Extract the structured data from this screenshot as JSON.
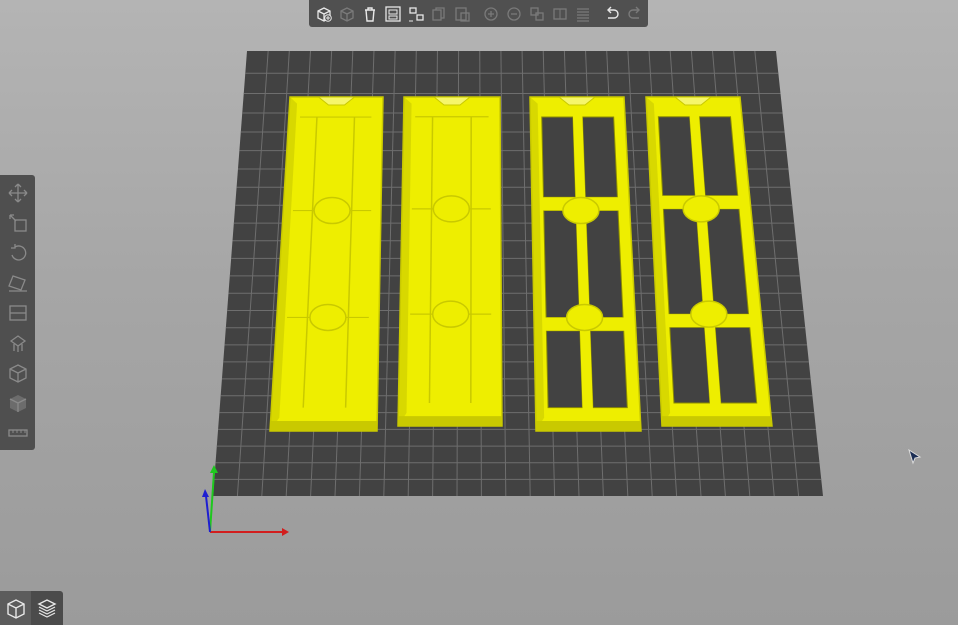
{
  "app": {
    "accent_color": "#eeee00",
    "bed_color": "#424242",
    "grid_color": "#6e6e6e"
  },
  "top_toolbar": {
    "buttons": [
      {
        "name": "add-button",
        "icon": "cube-add-icon",
        "enabled": true
      },
      {
        "name": "delete-button",
        "icon": "cube-delete-icon",
        "enabled": false
      },
      {
        "name": "delete-all-button",
        "icon": "trash-icon",
        "enabled": true
      },
      {
        "name": "arrange-button",
        "icon": "arrange-icon",
        "enabled": true
      },
      {
        "name": "arrange-selection-button",
        "icon": "arrange-selection-icon",
        "enabled": true
      },
      {
        "name": "copy-button",
        "icon": "copy-icon",
        "enabled": false
      },
      {
        "name": "paste-button",
        "icon": "paste-icon",
        "enabled": false
      },
      {
        "name": "add-instance-button",
        "icon": "plus-circle-icon",
        "enabled": false
      },
      {
        "name": "remove-instance-button",
        "icon": "minus-circle-icon",
        "enabled": false
      },
      {
        "name": "split-objects-button",
        "icon": "split-objects-icon",
        "enabled": false
      },
      {
        "name": "split-parts-button",
        "icon": "split-parts-icon",
        "enabled": false
      },
      {
        "name": "layers-editing-button",
        "icon": "layers-icon",
        "enabled": false
      },
      {
        "name": "undo-button",
        "icon": "undo-icon",
        "enabled": true
      },
      {
        "name": "redo-button",
        "icon": "redo-icon",
        "enabled": false
      }
    ]
  },
  "left_toolbar": {
    "tools": [
      {
        "name": "move-tool",
        "icon": "move-icon"
      },
      {
        "name": "scale-tool",
        "icon": "scale-icon"
      },
      {
        "name": "rotate-tool",
        "icon": "rotate-icon"
      },
      {
        "name": "place-on-face-tool",
        "icon": "place-on-face-icon"
      },
      {
        "name": "cut-tool",
        "icon": "cut-icon"
      },
      {
        "name": "support-points-tool",
        "icon": "support-points-icon"
      },
      {
        "name": "seam-painting-tool",
        "icon": "seam-icon"
      },
      {
        "name": "multimaterial-painting-tool",
        "icon": "mmu-paint-icon"
      },
      {
        "name": "measure-tool",
        "icon": "ruler-icon"
      }
    ]
  },
  "view_switch": {
    "views": [
      {
        "name": "3d-view",
        "icon": "cube-view-icon",
        "active": true
      },
      {
        "name": "preview-view",
        "icon": "layers-view-icon",
        "active": false
      }
    ]
  },
  "axes": {
    "x_color": "#d21e1e",
    "y_color": "#1ec81e",
    "z_color": "#1e1ed2"
  },
  "objects": [
    {
      "name": "part-1",
      "style": "solid"
    },
    {
      "name": "part-2",
      "style": "solid"
    },
    {
      "name": "part-3",
      "style": "frame"
    },
    {
      "name": "part-4",
      "style": "frame"
    }
  ]
}
